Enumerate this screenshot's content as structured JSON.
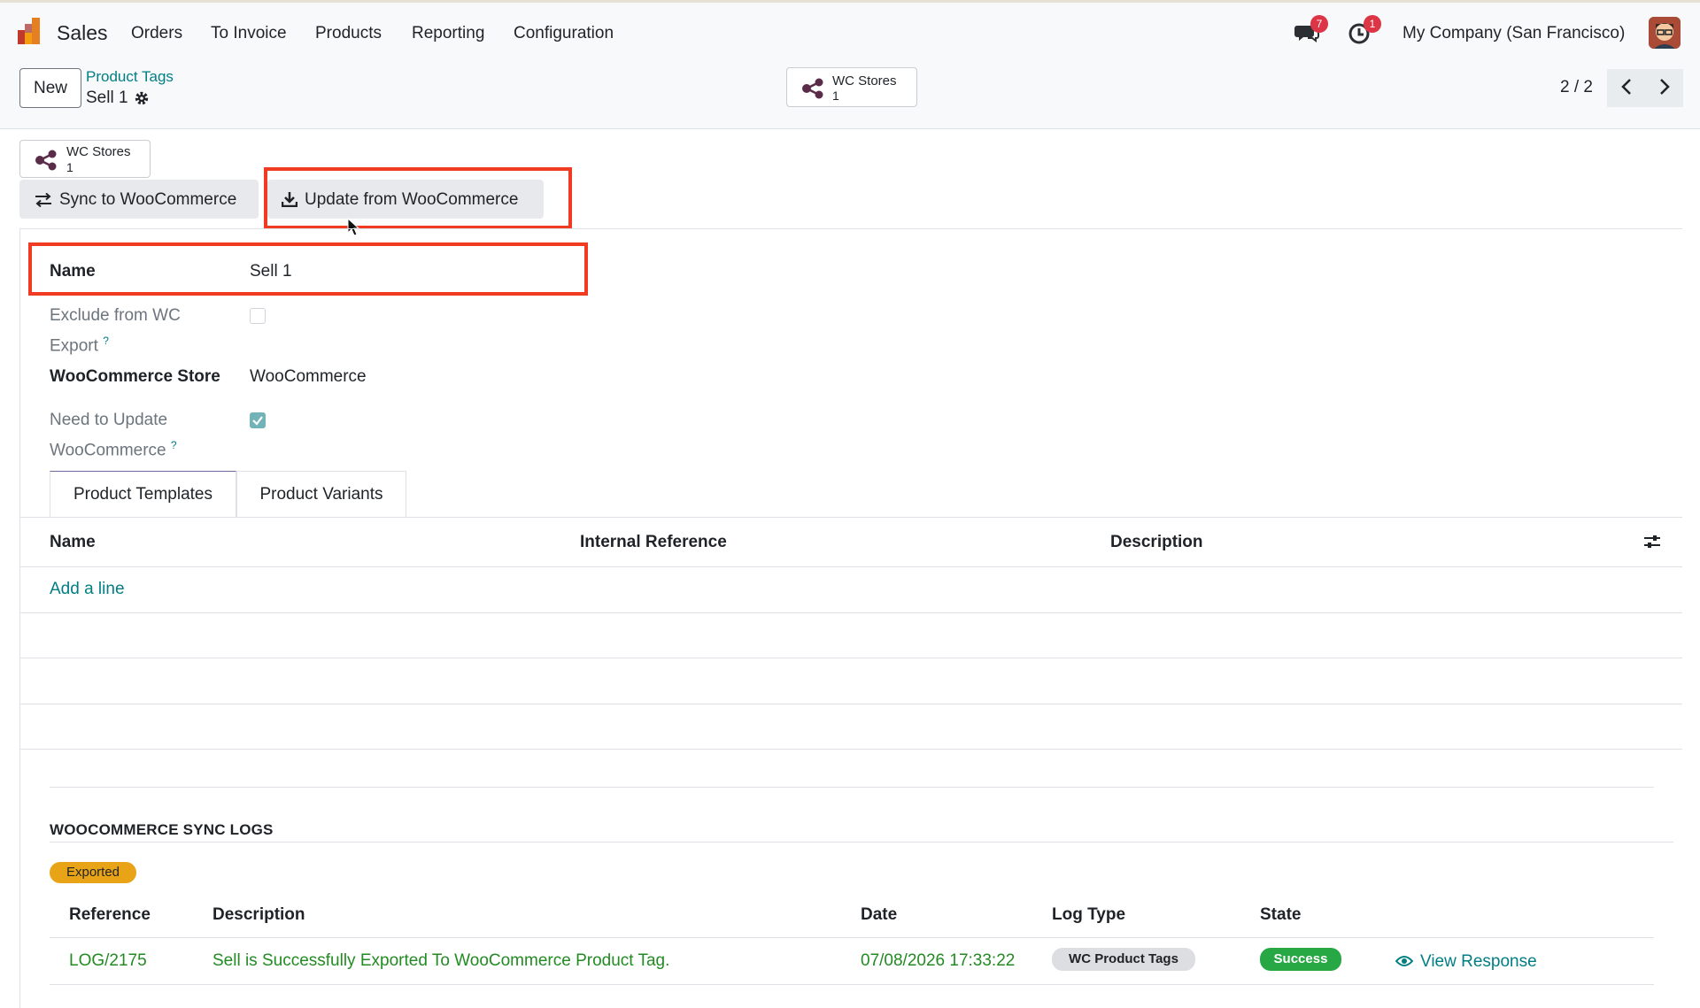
{
  "app": {
    "name": "Sales"
  },
  "nav": {
    "items": [
      "Orders",
      "To Invoice",
      "Products",
      "Reporting",
      "Configuration"
    ]
  },
  "systray": {
    "messages_count": "7",
    "activities_count": "1",
    "company": "My Company (San Francisco)"
  },
  "control": {
    "new_label": "New",
    "breadcrumb_parent": "Product Tags",
    "breadcrumb_current": "Sell 1",
    "wc_stores_title": "WC Stores",
    "wc_stores_count": "1",
    "pager": "2 / 2"
  },
  "actions": {
    "wc_stores_title": "WC Stores",
    "wc_stores_count": "1",
    "sync_label": "Sync to WooCommerce",
    "update_label": "Update from WooCommerce"
  },
  "form": {
    "name_label": "Name",
    "name_value": "Sell 1",
    "exclude_label_line1": "Exclude from WC",
    "exclude_label_line2": "Export",
    "exclude_checked": false,
    "store_label": "WooCommerce Store",
    "store_value": "WooCommerce",
    "need_update_label_line1": "Need to Update",
    "need_update_label_line2": "WooCommerce",
    "need_update_checked": true,
    "help_mark": "?"
  },
  "tabs": {
    "product_templates": "Product Templates",
    "product_variants": "Product Variants"
  },
  "table": {
    "columns": [
      "Name",
      "Internal Reference",
      "Description"
    ],
    "add_line": "Add a line"
  },
  "logs": {
    "title": "WOOCOMMERCE SYNC LOGS",
    "group_badge": "Exported",
    "columns": [
      "Reference",
      "Description",
      "Date",
      "Log Type",
      "State"
    ],
    "row": {
      "reference": "LOG/2175",
      "description": "Sell is Successfully Exported To WooCommerce Product Tag.",
      "date": "07/08/2026 17:33:22",
      "log_type": "WC Product Tags",
      "state": "Success",
      "action": "View Response"
    }
  },
  "colors": {
    "accent_teal": "#017e84",
    "highlight_red": "#f03a22",
    "success_green": "#28a745",
    "exported_orange": "#e8a317"
  }
}
